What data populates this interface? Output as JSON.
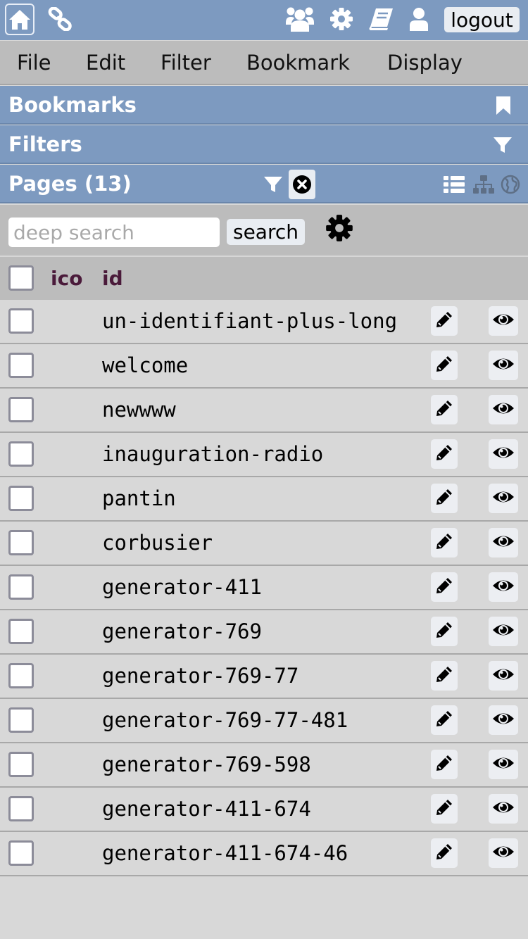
{
  "topbar": {
    "icons": [
      "home-icon",
      "link-icon",
      "users-icon",
      "gear-icon",
      "book-icon",
      "user-icon"
    ],
    "logout_label": "logout"
  },
  "menu": [
    "File",
    "Edit",
    "Filter",
    "Bookmark",
    "Display"
  ],
  "sections": {
    "bookmarks": "Bookmarks",
    "filters": "Filters",
    "pages": "Pages (13)"
  },
  "search": {
    "placeholder": "deep search",
    "button_label": "search"
  },
  "table": {
    "columns": [
      "ico",
      "id"
    ],
    "rows": [
      "un-identifiant-plus-long",
      "welcome",
      "newwww",
      "inauguration-radio",
      "pantin",
      "corbusier",
      "generator-411",
      "generator-769",
      "generator-769-77",
      "generator-769-77-481",
      "generator-769-598",
      "generator-411-674",
      "generator-411-674-46"
    ]
  },
  "colors": {
    "header_blue": "#7d9ac0",
    "menu_gray": "#bcbcbc",
    "background": "#d8d8d8",
    "column_header": "#4a1a3a"
  }
}
